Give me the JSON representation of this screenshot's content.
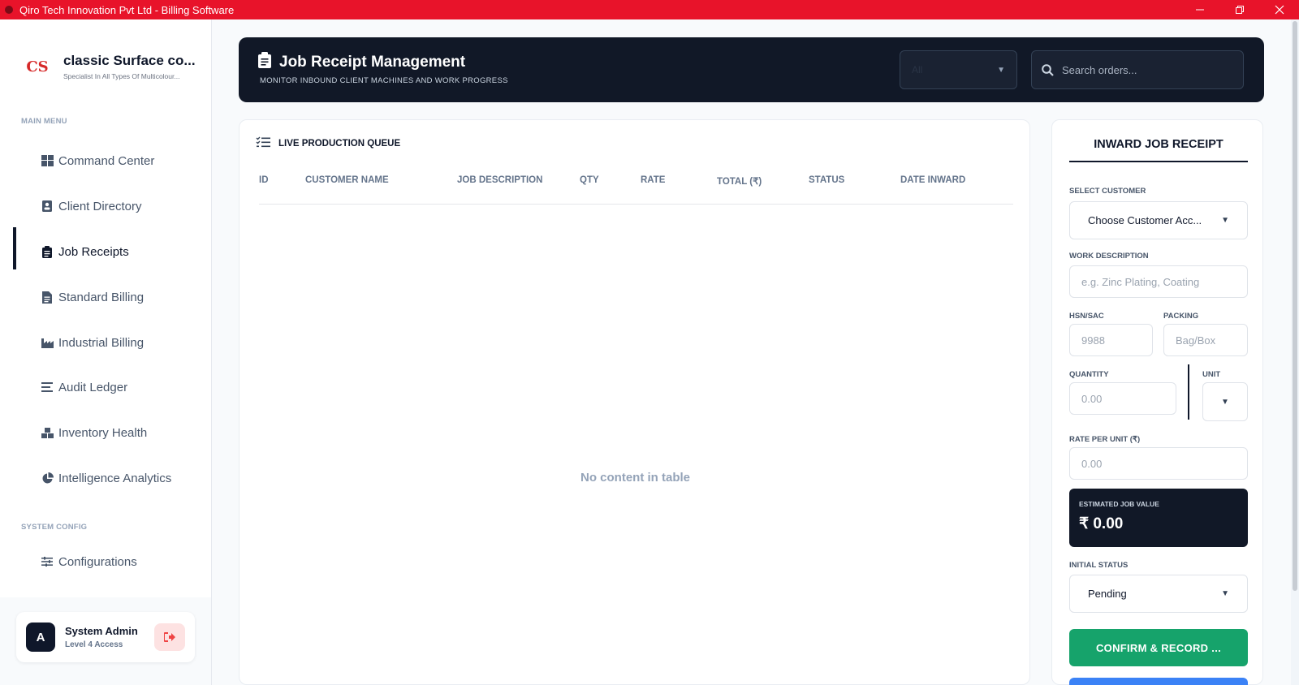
{
  "window": {
    "title": "Qiro Tech Innovation Pvt Ltd - Billing Software",
    "controls": [
      "minimize",
      "restore",
      "close"
    ]
  },
  "brand": {
    "logo_text": "CS",
    "name": "classic Surface co...",
    "tagline": "Specialist In All Types Of Multicolour..."
  },
  "sidebar": {
    "main_menu_label": "MAIN MENU",
    "items": [
      {
        "label": "Command Center",
        "icon": "grid-icon"
      },
      {
        "label": "Client Directory",
        "icon": "contact-card-icon"
      },
      {
        "label": "Job Receipts",
        "icon": "clipboard-icon",
        "active": true
      },
      {
        "label": "Standard Billing",
        "icon": "document-icon"
      },
      {
        "label": "Industrial Billing",
        "icon": "factory-icon"
      },
      {
        "label": "Audit Ledger",
        "icon": "lines-icon"
      },
      {
        "label": "Inventory Health",
        "icon": "boxes-icon"
      },
      {
        "label": "Intelligence Analytics",
        "icon": "pie-chart-icon"
      }
    ],
    "system_config_label": "SYSTEM CONFIG",
    "config_item": {
      "label": "Configurations",
      "icon": "sliders-icon"
    }
  },
  "user": {
    "avatar_letter": "A",
    "name": "System Admin",
    "level": "Level 4 Access"
  },
  "header": {
    "title": "Job Receipt Management",
    "subtitle": "MONITOR INBOUND CLIENT MACHINES AND WORK PROGRESS",
    "filter_value": "All",
    "search_placeholder": "Search orders..."
  },
  "queue": {
    "title": "LIVE PRODUCTION QUEUE",
    "columns": [
      "ID",
      "CUSTOMER NAME",
      "JOB DESCRIPTION",
      "QTY",
      "RATE",
      "TOTAL (₹)",
      "STATUS",
      "DATE INWARD"
    ],
    "empty_message": "No content in table"
  },
  "form": {
    "title": "INWARD JOB RECEIPT",
    "customer_label": "SELECT CUSTOMER",
    "customer_value": "Choose Customer Acc...",
    "work_label": "WORK DESCRIPTION",
    "work_placeholder": "e.g. Zinc Plating, Coating",
    "hsn_label": "HSN/SAC",
    "hsn_placeholder": "9988",
    "packing_label": "PACKING",
    "packing_placeholder": "Bag/Box",
    "quantity_label": "QUANTITY",
    "quantity_placeholder": "0.00",
    "unit_label": "UNIT",
    "rate_label": "RATE PER UNIT (₹)",
    "rate_placeholder": "0.00",
    "estimate_label": "ESTIMATED JOB VALUE",
    "estimate_value": "₹ 0.00",
    "status_label": "INITIAL STATUS",
    "status_value": "Pending",
    "confirm_label": "CONFIRM & RECORD ..."
  },
  "colors": {
    "titlebar": "#e8132a",
    "header_bg": "#111827",
    "confirm_green": "#16a36b",
    "secondary_blue": "#3b82f6"
  }
}
